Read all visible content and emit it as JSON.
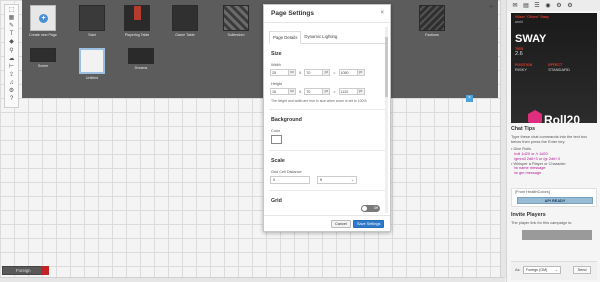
{
  "toolbar": {
    "tools": [
      "select-icon",
      "map-icon",
      "pencil-icon",
      "text-icon",
      "dice-icon",
      "zoom-icon",
      "fog-icon",
      "ruler-icon",
      "upload-icon",
      "jukebox-icon",
      "settings-icon",
      "help-icon"
    ]
  },
  "pages": [
    {
      "label": "Create new Page",
      "style": "new"
    },
    {
      "label": "Start",
      "style": "dark"
    },
    {
      "label": "Playerlog Table",
      "style": "dark"
    },
    {
      "label": "Game Table",
      "style": "dark"
    },
    {
      "label": "Sollendom",
      "style": "dark"
    },
    {
      "label": "Factions",
      "style": "dark"
    },
    {
      "label": "Scene",
      "style": "dark"
    },
    {
      "label": "Untitled",
      "style": "selected"
    },
    {
      "label": "Dreams",
      "style": "dark"
    }
  ],
  "modal": {
    "title": "Page Settings",
    "close": "×",
    "tabs": [
      "Page Details",
      "Dynamic Lighting"
    ],
    "size_heading": "Size",
    "width_label": "Width",
    "width_units": "25",
    "width_unit_suffix": "un",
    "width_px": "70",
    "width_px_suffix": "px",
    "width_total": "1050",
    "width_total_suffix": "px",
    "height_label": "Height",
    "height_units": "16",
    "height_unit_suffix": "un",
    "height_px": "70",
    "height_px_suffix": "px",
    "height_total": "1120",
    "height_total_suffix": "px",
    "times": "X",
    "equals": "=",
    "size_note": "The height and width are true to size when zoom is set to 100%.",
    "background_heading": "Background",
    "color_label": "Color",
    "scale_heading": "Scale",
    "grid_cell_label": "Grid Cell Distance",
    "grid_cell_value": "5",
    "grid_cell_unit": "ft",
    "grid_heading": "Grid",
    "grid_toggle": "Off",
    "cancel": "Cancel",
    "save": "Save Settings"
  },
  "layer": {
    "label": "Foreign"
  },
  "zoom_label": "+",
  "right_panel": {
    "top_icons": [
      "chat-icon",
      "book-icon",
      "journal-icon",
      "compendium-icon",
      "gear-icon",
      "settings-icon"
    ],
    "banner_head": "Villain \"Citizen\" Sway",
    "banner_sub": "world",
    "banner_name": "SWAY",
    "banner_k1": "TIER",
    "banner_v1": "2.6",
    "banner_k2": "POSITION",
    "banner_v2": "RISKY",
    "banner_k3": "EFFECT",
    "banner_v3": "STANDARD",
    "brand": "Roll20",
    "chat_tips_title": "Chat Tips",
    "chat_tips_intro": "Type these chat commands into the text box below then press the Enter key.",
    "tip_dice": "• Dice Rolls",
    "tip_roll_code": "/roll 1d20 or /r 1d20",
    "tip_gmroll_code": "/gmroll 2d6+3 or /gr 2d6+3",
    "tip_whisper": "• Whisper a Player or Character",
    "tip_whisper_code": "/w name message",
    "tip_gm_code": "/w gm message",
    "from_label": "[From HealthColors]",
    "api_ready": "API READY",
    "invite_title": "Invite Players",
    "invite_text": "The player link for this campaign is:",
    "as_label": "As:",
    "as_value": "Foreign (GM)",
    "send": "Send"
  }
}
